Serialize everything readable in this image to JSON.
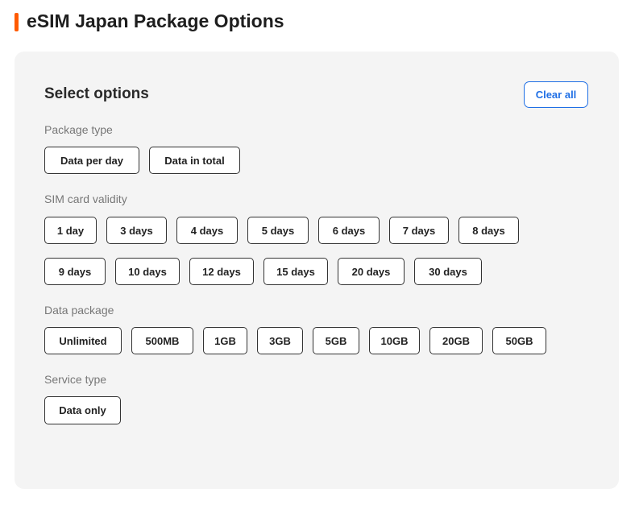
{
  "page_title": "eSIM Japan Package Options",
  "colors": {
    "accent": "#ff5a00",
    "link": "#1f6fe5"
  },
  "panel": {
    "heading": "Select options",
    "clear_label": "Clear all"
  },
  "groups": [
    {
      "label": "Package type",
      "options": [
        "Data per day",
        "Data in total"
      ]
    },
    {
      "label": "SIM card validity",
      "options": [
        "1 day",
        "3 days",
        "4 days",
        "5 days",
        "6 days",
        "7 days",
        "8 days",
        "9 days",
        "10 days",
        "12 days",
        "15 days",
        "20 days",
        "30 days"
      ]
    },
    {
      "label": "Data package",
      "options": [
        "Unlimited",
        "500MB",
        "1GB",
        "3GB",
        "5GB",
        "10GB",
        "20GB",
        "50GB"
      ]
    },
    {
      "label": "Service type",
      "options": [
        "Data only"
      ]
    }
  ]
}
